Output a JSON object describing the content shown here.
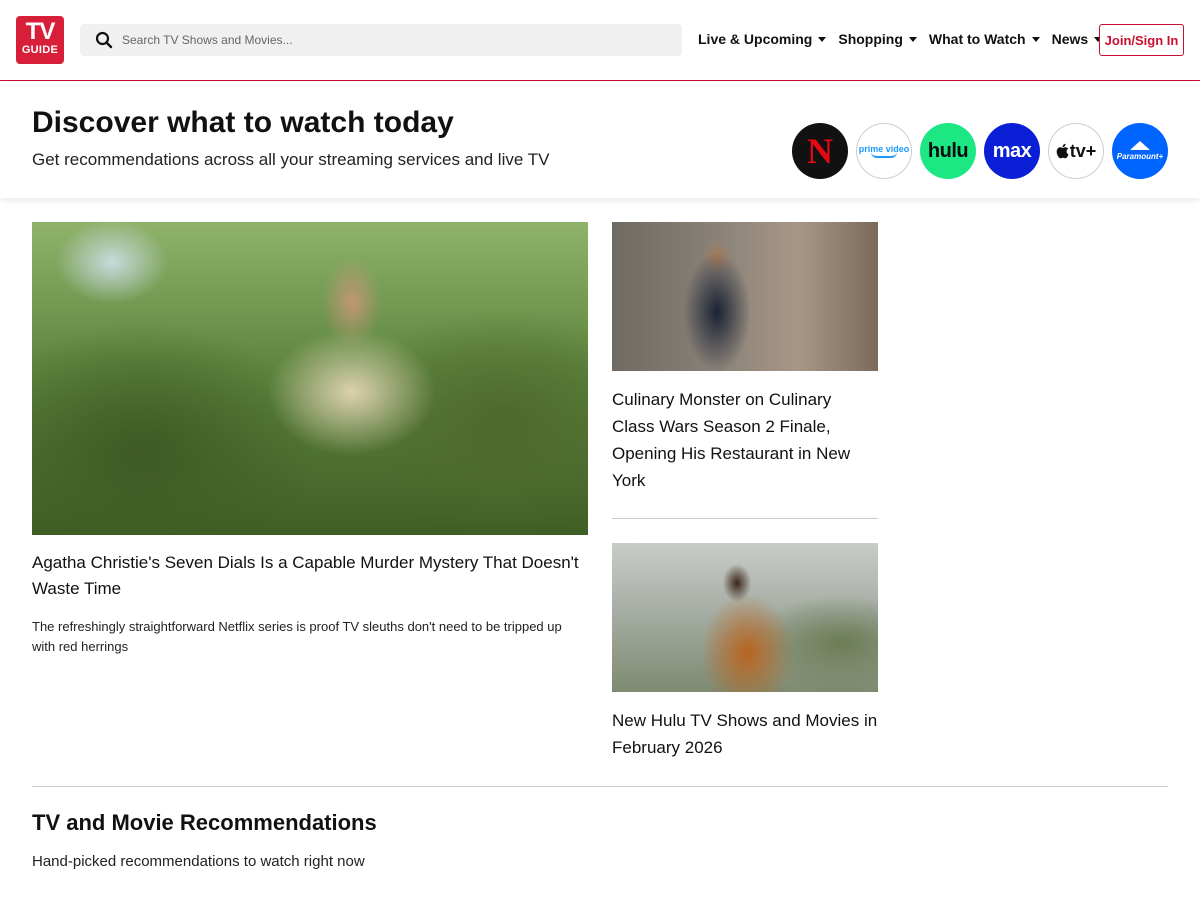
{
  "header": {
    "logo": {
      "line1": "TV",
      "line2": "GUIDE",
      "color": "#d81f3a"
    },
    "search": {
      "placeholder": "Search TV Shows and Movies...",
      "value": "",
      "icon": "search-icon"
    },
    "nav": [
      {
        "label": "Live & Upcoming",
        "icon": "chevron-down-icon"
      },
      {
        "label": "Shopping",
        "icon": "chevron-down-icon"
      },
      {
        "label": "What to Watch",
        "icon": "chevron-down-icon"
      },
      {
        "label": "News",
        "icon": "chevron-down-icon"
      }
    ],
    "join_label": "Join/Sign In",
    "accent_color": "#c8102e"
  },
  "discover": {
    "title": "Discover what to watch today",
    "subtitle": "Get recommendations across all your streaming services and live TV",
    "services": [
      {
        "name": "netflix-logo",
        "label": "N",
        "color": "#e50914"
      },
      {
        "name": "prime-video-logo",
        "label": "prime video",
        "color": "#1a98ff"
      },
      {
        "name": "hulu-logo",
        "label": "hulu",
        "color": "#1ce783"
      },
      {
        "name": "max-logo",
        "label": "max",
        "color": "#0a1fd6"
      },
      {
        "name": "apple-tv-logo",
        "label": "tv+",
        "color": "#111111"
      },
      {
        "name": "paramount-plus-logo",
        "label": "Paramount+",
        "color": "#0064ff"
      }
    ]
  },
  "articles": {
    "main": {
      "title": "Agatha Christie's Seven Dials Is a Capable Murder Mystery That Doesn't Waste Time",
      "dek": "The refreshingly straightforward Netflix series is proof TV sleuths don't need to be tripped up with red herrings"
    },
    "side": [
      {
        "title": "Culinary Monster on Culinary Class Wars Season 2 Finale, Opening His Restaurant in New York"
      },
      {
        "title": "New Hulu TV Shows and Movies in February 2026"
      }
    ]
  },
  "recommendations": {
    "title": "TV and Movie Recommendations",
    "subtitle": "Hand-picked recommendations to watch right now"
  }
}
